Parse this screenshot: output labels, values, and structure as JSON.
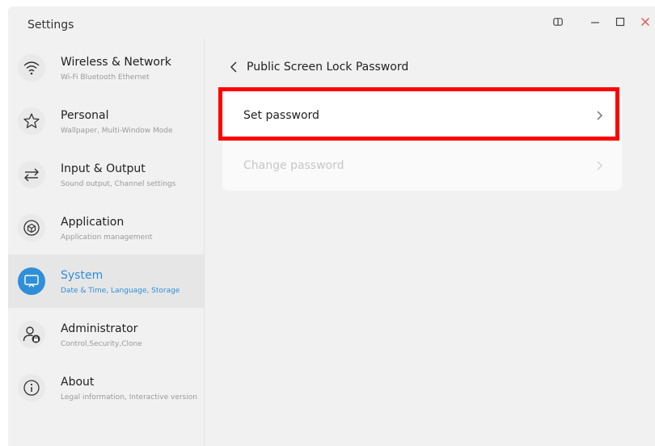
{
  "window": {
    "title": "Settings",
    "controls": {
      "split_icon": "split-view-icon",
      "minimize_icon": "minimize-icon",
      "maximize_icon": "maximize-icon",
      "close_icon": "close-icon"
    }
  },
  "sidebar": {
    "items": [
      {
        "label": "Wireless & Network",
        "sub": "Wi-Fi Bluetooth Ethernet",
        "icon": "wifi-icon",
        "active": false
      },
      {
        "label": "Personal",
        "sub": "Wallpaper, Multi-Window Mode",
        "icon": "star-icon",
        "active": false
      },
      {
        "label": "Input & Output",
        "sub": "Sound output, Channel settings",
        "icon": "swap-arrows-icon",
        "active": false
      },
      {
        "label": "Application",
        "sub": "Application management",
        "icon": "cube-icon",
        "active": false
      },
      {
        "label": "System",
        "sub": "Date & Time, Language, Storage",
        "icon": "monitor-icon",
        "active": true
      },
      {
        "label": "Administrator",
        "sub": "Control,Security,Clone",
        "icon": "admin-lock-icon",
        "active": false
      },
      {
        "label": "About",
        "sub": "Legal information, Interactive version",
        "icon": "info-icon",
        "active": false
      }
    ]
  },
  "content": {
    "back_icon": "chevron-left-icon",
    "title": "Public Screen Lock Password",
    "rows": [
      {
        "label": "Set password",
        "enabled": true,
        "icon": "chevron-right-icon"
      },
      {
        "label": "Change password",
        "enabled": false,
        "icon": "chevron-right-icon"
      }
    ]
  },
  "colors": {
    "accent": "#2f8fd8",
    "highlight": "#ff0000",
    "close": "#e05252",
    "disabled_text": "#c7c7c7"
  }
}
